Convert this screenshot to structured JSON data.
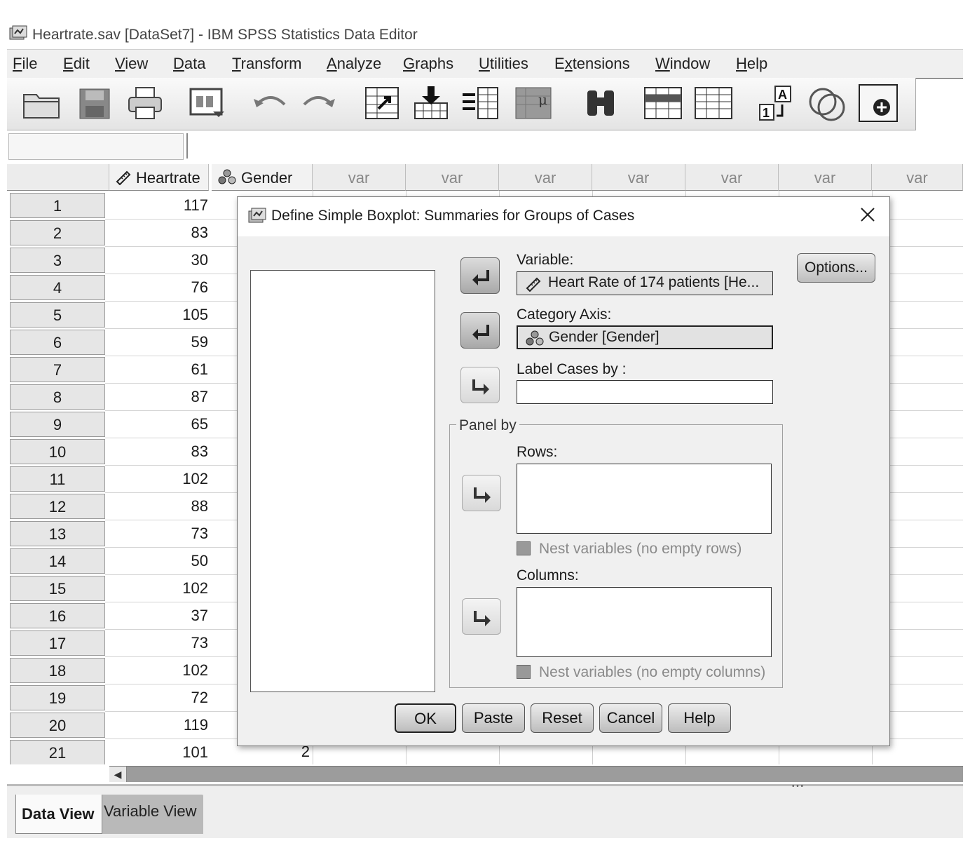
{
  "window": {
    "title": "Heartrate.sav [DataSet7] - IBM SPSS Statistics Data Editor"
  },
  "menu": [
    "File",
    "Edit",
    "View",
    "Data",
    "Transform",
    "Analyze",
    "Graphs",
    "Utilities",
    "Extensions",
    "Window",
    "Help"
  ],
  "toolbar_icons": [
    "open-folder-icon",
    "save-icon",
    "print-icon",
    "dialog-recall-icon",
    "undo-icon",
    "redo-icon",
    "goto-case-icon",
    "goto-variable-icon",
    "variables-icon",
    "run-descriptives-icon",
    "find-icon",
    "insert-cases-icon",
    "insert-variable-icon",
    "value-labels-icon",
    "use-variable-sets-icon",
    "show-all-variables-icon"
  ],
  "grid": {
    "columns": [
      "Heartrate",
      "Gender",
      "var",
      "var",
      "var",
      "var",
      "var",
      "var",
      "var"
    ],
    "row_numbers": [
      "1",
      "2",
      "3",
      "4",
      "5",
      "6",
      "7",
      "8",
      "9",
      "10",
      "11",
      "12",
      "13",
      "14",
      "15",
      "16",
      "17",
      "18",
      "19",
      "20",
      "21"
    ],
    "heartrate_values": [
      "117",
      "83",
      "30",
      "76",
      "105",
      "59",
      "61",
      "87",
      "65",
      "83",
      "102",
      "88",
      "73",
      "50",
      "102",
      "37",
      "73",
      "102",
      "72",
      "119",
      "101"
    ],
    "gender_visible_value": "2"
  },
  "tabs": {
    "data_view": "Data View",
    "variable_view": "Variable View"
  },
  "dialog": {
    "title": "Define Simple Boxplot: Summaries for Groups of Cases",
    "variable_label": "Variable:",
    "variable_value": "Heart Rate of 174 patients [He...",
    "category_axis_label": "Category Axis:",
    "category_axis_value": "Gender [Gender]",
    "label_cases_label": "Label Cases by :",
    "label_cases_value": "",
    "panel_by": "Panel by",
    "rows_label": "Rows:",
    "nest_rows": "Nest variables (no empty rows)",
    "columns_label": "Columns:",
    "nest_columns": "Nest variables (no empty columns)",
    "buttons": {
      "options": "Options...",
      "ok": "OK",
      "paste": "Paste",
      "reset": "Reset",
      "cancel": "Cancel",
      "help": "Help"
    }
  }
}
